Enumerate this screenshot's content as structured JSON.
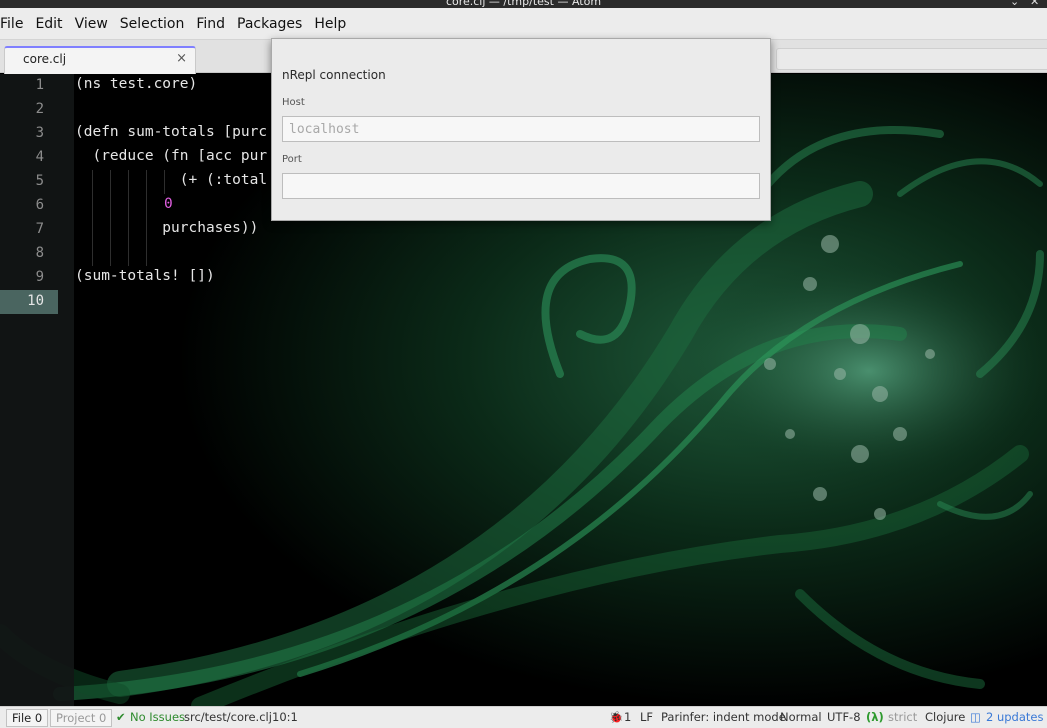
{
  "window": {
    "title": "core.clj — /tmp/test — Atom",
    "controls": [
      "⌃",
      "⌄",
      "✕"
    ]
  },
  "menu": [
    "File",
    "Edit",
    "View",
    "Selection",
    "Find",
    "Packages",
    "Help"
  ],
  "tab": {
    "title": "core.clj",
    "close": "×"
  },
  "editor": {
    "line_numbers": [
      "1",
      "2",
      "3",
      "4",
      "5",
      "6",
      "7",
      "8",
      "9",
      "10"
    ],
    "active_line": "10",
    "lines": [
      "(ns test.core)",
      "",
      "(defn sum-totals [purc",
      "  (reduce (fn [acc pur",
      "            (+ (:total",
      "          0",
      "          purchases))",
      "",
      "(sum-totals! [])",
      ""
    ],
    "literal_zero": "0"
  },
  "dialog": {
    "heading": "nRepl connection",
    "host_label": "Host",
    "host_placeholder": "localhost",
    "port_label": "Port",
    "port_value": ""
  },
  "status": {
    "file": "File 0",
    "project": "Project 0",
    "check_mark": "✔",
    "issues": "No Issues",
    "path": "src/test/core.clj",
    "cursor": "10:1",
    "bug_count": "1",
    "line_ending": "LF",
    "parinfer": "Parinfer: indent mode",
    "vim_mode": "Normal",
    "encoding": "UTF-8",
    "lambda": "(λ)",
    "strict": "strict",
    "grammar": "Clojure",
    "updates": "2 updates"
  },
  "colors": {
    "tab_accent": "#8080ff",
    "active_line_number_bg": "#4a6560",
    "number_literal": "#e05fe0",
    "ok": "#2e8b2e",
    "link": "#3a79d6"
  }
}
